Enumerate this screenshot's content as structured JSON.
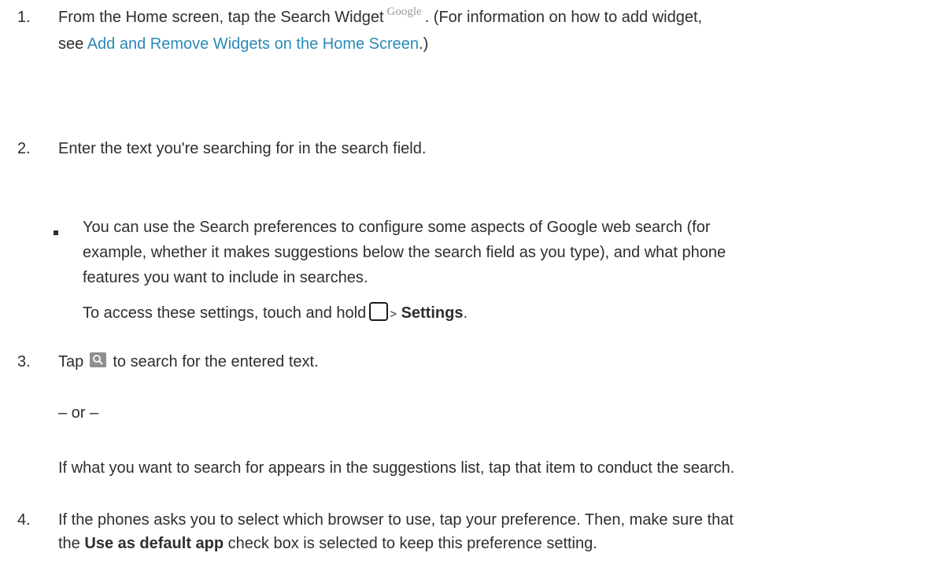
{
  "step1": {
    "number": "1.",
    "text_a": "From the Home screen, tap the Search Widget",
    "widget_logo": "Google",
    "text_b": ". (For information on how to add widget,",
    "text_c": "see",
    "link": "Add and Remove Widgets on the Home Screen",
    "text_d": ".)"
  },
  "step2": {
    "number": "2.",
    "text": "Enter the text you're searching for in the search field."
  },
  "note": {
    "line1": "You can use the Search preferences to configure some aspects of Google web search (for",
    "line2": "example, whether it makes suggestions below the search field as you type), and what phone",
    "line3": "features you want to include in searches.",
    "access_a": "To access these settings, touch and hold",
    "access_sep": ">",
    "access_bold": "Settings",
    "access_end": "."
  },
  "step3": {
    "number": "3.",
    "tap": "Tap",
    "text": "to search for the entered text.",
    "or": "– or –",
    "alt": "If what you want to search for appears in the suggestions list, tap that item to conduct the search."
  },
  "step4": {
    "number": "4.",
    "line1": "If the phones asks you to select which browser to use, tap your preference. Then, make sure that",
    "line2a": "the",
    "line2_bold": "Use as default app",
    "line2b": "check box is selected to keep this preference setting."
  },
  "icons": {
    "widget": "google-search-widget-icon",
    "home": "home-button-icon",
    "search": "search-button-icon"
  }
}
